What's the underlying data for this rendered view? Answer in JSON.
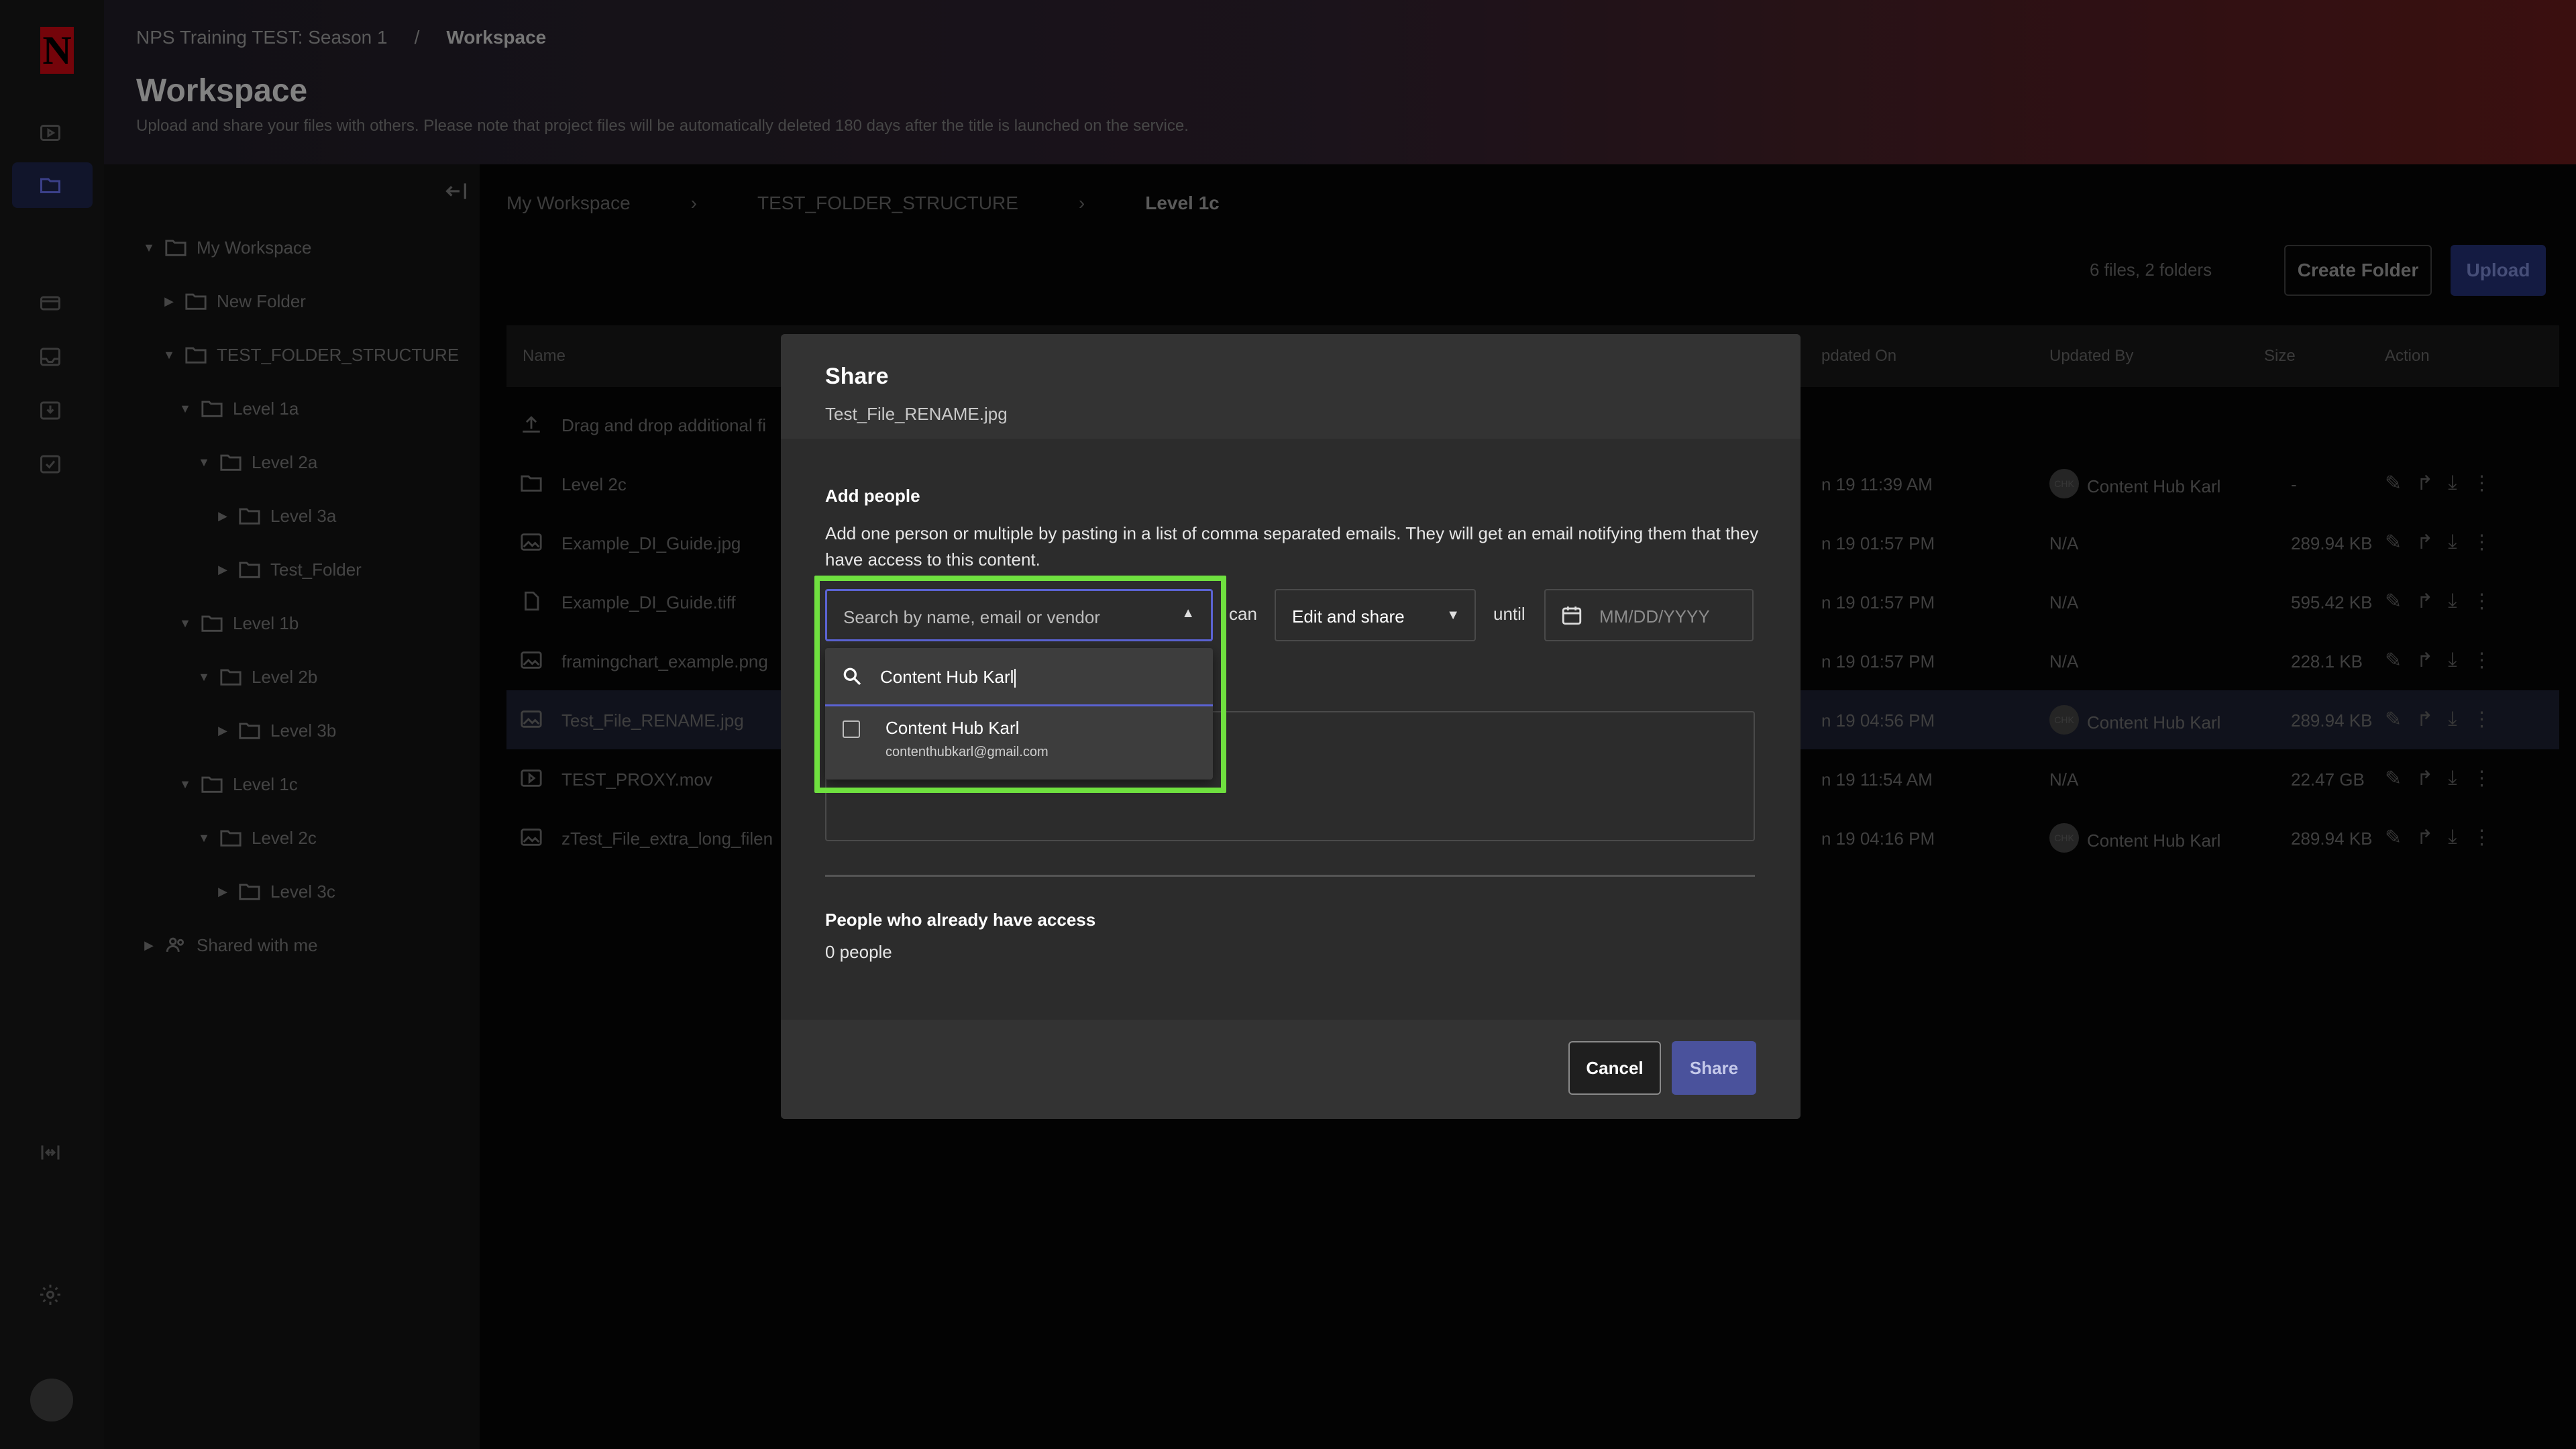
{
  "header": {
    "breadcrumb_project": "NPS Training TEST: Season 1",
    "breadcrumb_sep": "/",
    "breadcrumb_current": "Workspace",
    "title": "Workspace",
    "subtitle": "Upload and share your files with others. Please note that project files will be automatically deleted 180 days after the title is launched on the service."
  },
  "rail": {
    "logo": "N"
  },
  "tree": {
    "items": [
      {
        "label": "My Workspace"
      },
      {
        "label": "New Folder"
      },
      {
        "label": "TEST_FOLDER_STRUCTURE"
      },
      {
        "label": "Level 1a"
      },
      {
        "label": "Level 2a"
      },
      {
        "label": "Level 3a"
      },
      {
        "label": "Test_Folder"
      },
      {
        "label": "Level 1b"
      },
      {
        "label": "Level 2b"
      },
      {
        "label": "Level 3b"
      },
      {
        "label": "Level 1c"
      },
      {
        "label": "Level 2c"
      },
      {
        "label": "Level 3c"
      },
      {
        "label": "Shared with me"
      }
    ]
  },
  "main": {
    "breadcrumb": [
      "My Workspace",
      "TEST_FOLDER_STRUCTURE",
      "Level 1c"
    ],
    "files_count": "6 files, 2 folders",
    "create_folder_label": "Create Folder",
    "upload_label": "Upload",
    "columns": {
      "name": "Name",
      "updated_on": "pdated On",
      "updated_by": "Updated By",
      "size": "Size",
      "action": "Action"
    },
    "rows": [
      {
        "name": "Drag and drop additional fi",
        "updated_on": "",
        "updated_by": "",
        "size": ""
      },
      {
        "name": "Level 2c",
        "updated_on": "n 19 11:39 AM",
        "updated_by": "Content Hub Karl",
        "avatar": "CHK",
        "size": "-"
      },
      {
        "name": "Example_DI_Guide.jpg",
        "updated_on": "n 19 01:57 PM",
        "updated_by": "N/A",
        "size": "289.94 KB"
      },
      {
        "name": "Example_DI_Guide.tiff",
        "updated_on": "n 19 01:57 PM",
        "updated_by": "N/A",
        "size": "595.42 KB"
      },
      {
        "name": "framingchart_example.png",
        "updated_on": "n 19 01:57 PM",
        "updated_by": "N/A",
        "size": "228.1 KB"
      },
      {
        "name": "Test_File_RENAME.jpg",
        "updated_on": "n 19 04:56 PM",
        "updated_by": "Content Hub Karl",
        "avatar": "CHK",
        "size": "289.94 KB"
      },
      {
        "name": "TEST_PROXY.mov",
        "updated_on": "n 19 11:54 AM",
        "updated_by": "N/A",
        "size": "22.47 GB"
      },
      {
        "name": "zTest_File_extra_long_filen",
        "updated_on": "n 19 04:16 PM",
        "updated_by": "Content Hub Karl",
        "avatar": "CHK",
        "size": "289.94 KB"
      }
    ]
  },
  "modal": {
    "title": "Share",
    "file_name": "Test_File_RENAME.jpg",
    "add_people_heading": "Add people",
    "add_people_desc": "Add one person or multiple by pasting in a list of comma separated emails. They will get an email notifying them that they have access to this content.",
    "search_placeholder": "Search by name, email or vendor",
    "can_label": "can",
    "permission_value": "Edit and share",
    "until_label": "until",
    "date_placeholder": "MM/DD/YYYY",
    "people_heading": "People who already have access",
    "people_count": "0 people",
    "cancel_label": "Cancel",
    "share_label": "Share"
  },
  "dropdown": {
    "query": "Content Hub Karl",
    "option_name": "Content Hub Karl",
    "option_email": "contenthubkarl@gmail.com"
  },
  "colors": {
    "highlight": "#6fe03f",
    "accent": "#5b63d3",
    "share_button": "#4a529c"
  }
}
